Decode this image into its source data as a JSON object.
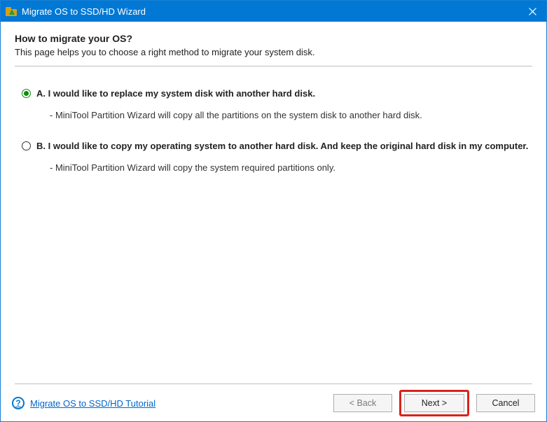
{
  "titleBar": {
    "title": "Migrate OS to SSD/HD Wizard"
  },
  "header": {
    "title": "How to migrate your OS?",
    "subtitle": "This page helps you to choose a right method to migrate your system disk."
  },
  "options": [
    {
      "label": "A. I would like to replace my system disk with another hard disk.",
      "description": "- MiniTool Partition Wizard will copy all the partitions on the system disk to another hard disk.",
      "checked": true
    },
    {
      "label": "B. I would like to copy my operating system to another hard disk. And keep the original hard disk in my computer.",
      "description": "- MiniTool Partition Wizard will copy the system required partitions only.",
      "checked": false
    }
  ],
  "footer": {
    "tutorialLink": "Migrate OS to SSD/HD Tutorial",
    "backButton": "< Back",
    "nextButton": "Next >",
    "cancelButton": "Cancel"
  }
}
